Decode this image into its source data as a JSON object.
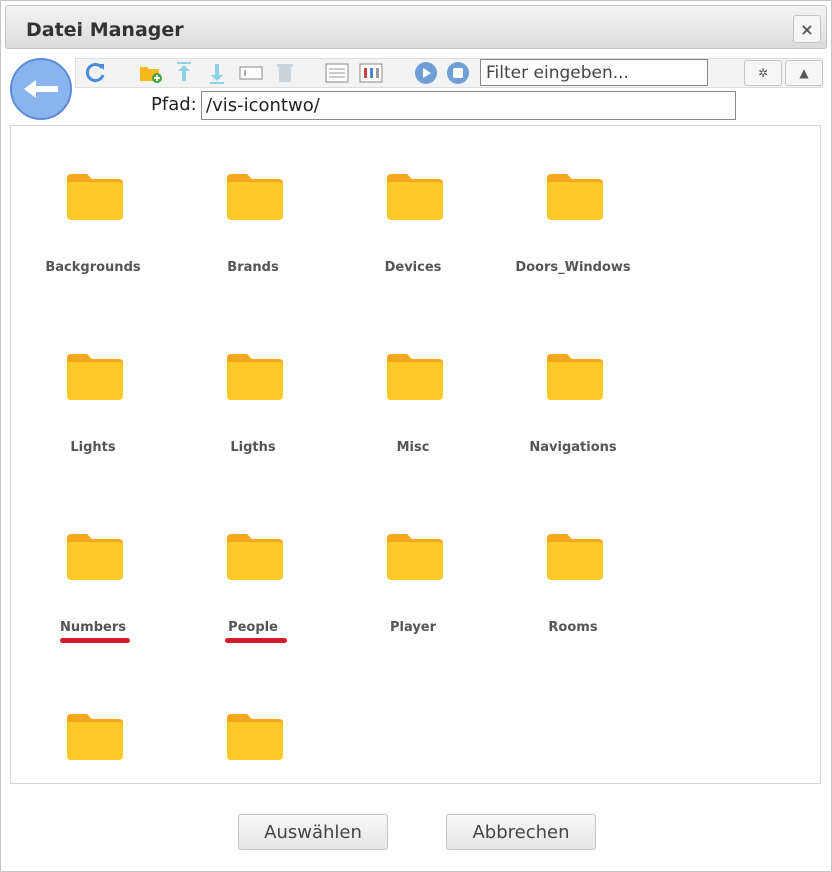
{
  "dialog": {
    "title": "Datei Manager",
    "close_label": "×"
  },
  "toolbar": {
    "buttons": [
      {
        "icon": "refresh-icon"
      },
      {
        "icon": "new-folder-icon"
      },
      {
        "icon": "upload-icon"
      },
      {
        "icon": "download-icon"
      },
      {
        "icon": "rename-icon"
      },
      {
        "icon": "delete-icon"
      },
      {
        "icon": "list-view-icon"
      },
      {
        "icon": "details-view-icon"
      },
      {
        "icon": "play-icon"
      },
      {
        "icon": "stop-icon"
      }
    ],
    "filter_placeholder": "Filter eingeben...",
    "right_buttons": [
      {
        "icon": "gear-icon",
        "glyph": "✲"
      },
      {
        "icon": "warning-icon",
        "glyph": "▲"
      }
    ]
  },
  "path": {
    "label": "Pfad:",
    "value": "/vis-icontwo/"
  },
  "folders": [
    {
      "name": "Backgrounds"
    },
    {
      "name": "Brands"
    },
    {
      "name": "Devices"
    },
    {
      "name": "Doors_Windows"
    },
    {
      "name": "Lights",
      "underlined": true
    },
    {
      "name": "Ligths",
      "underlined": true
    },
    {
      "name": "Misc"
    },
    {
      "name": "Navigations"
    },
    {
      "name": "Numbers"
    },
    {
      "name": "People"
    },
    {
      "name": "Player"
    },
    {
      "name": "Rooms"
    },
    {
      "name": ""
    },
    {
      "name": ""
    }
  ],
  "colors": {
    "folder": "#ffc929",
    "folder_tab": "#f6a81c",
    "underline": "#d41b2c",
    "back_button": "#8ab4f0"
  },
  "footer": {
    "select_label": "Auswählen",
    "cancel_label": "Abbrechen"
  }
}
